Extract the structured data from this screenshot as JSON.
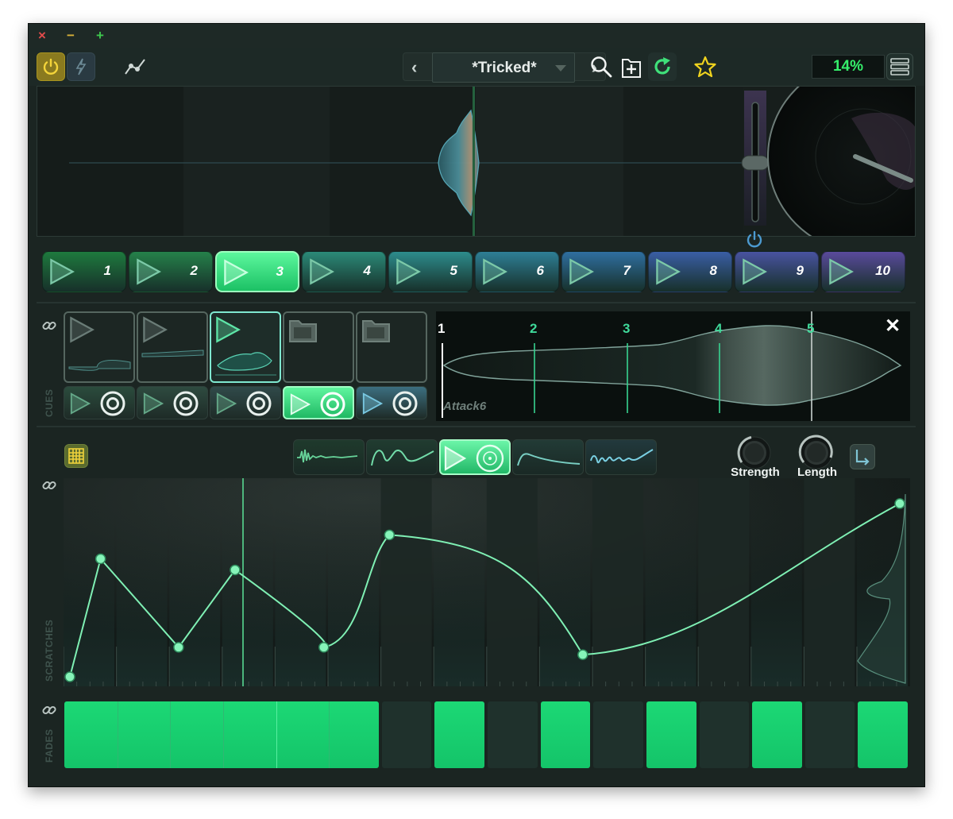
{
  "window": {
    "close_glyph": "×",
    "minimize_glyph": "−",
    "maximize_glyph": "+"
  },
  "toolbar": {
    "power_icon": "power-icon",
    "bolt_icon": "lightning-icon",
    "automation_icon": "curve-icon",
    "prev_glyph": "‹",
    "next_glyph": "›",
    "preset_name": "*Tricked*",
    "search_icon": "search-icon",
    "new_icon": "new-file-icon",
    "refresh_icon": "refresh-icon",
    "favorite_icon": "star-icon",
    "cpu_percent": "14%",
    "menu_icon": "menu-icon"
  },
  "pads": {
    "labels": [
      "1",
      "2",
      "3",
      "4",
      "5",
      "6",
      "7",
      "8",
      "9",
      "10"
    ],
    "active_index": 2
  },
  "cues": {
    "section_label": "CUES",
    "sample_name": "Attack6",
    "markers": [
      "1",
      "2",
      "3",
      "4",
      "5"
    ],
    "close_glyph": "✕"
  },
  "scratches": {
    "section_label": "SCRATCHES",
    "strength_label": "Strength",
    "length_label": "Length",
    "active_mode_index": 2,
    "curve_points": [
      [
        0.0,
        0.0
      ],
      [
        0.037,
        0.64
      ],
      [
        0.131,
        0.16
      ],
      [
        0.199,
        0.58
      ],
      [
        0.306,
        0.16
      ],
      [
        0.385,
        0.77
      ],
      [
        0.618,
        0.12
      ],
      [
        1.0,
        0.94
      ]
    ]
  },
  "fades": {
    "section_label": "FADES",
    "steps": [
      1,
      1,
      1,
      1,
      1,
      1,
      0,
      1,
      0,
      1,
      0,
      1,
      0,
      1,
      0,
      1
    ]
  },
  "colors": {
    "accent": "#23e07c",
    "accent_light": "#7df0b4",
    "background": "#1b2522",
    "preset_text": "#e7ecea",
    "percent_text": "#35f06b"
  }
}
